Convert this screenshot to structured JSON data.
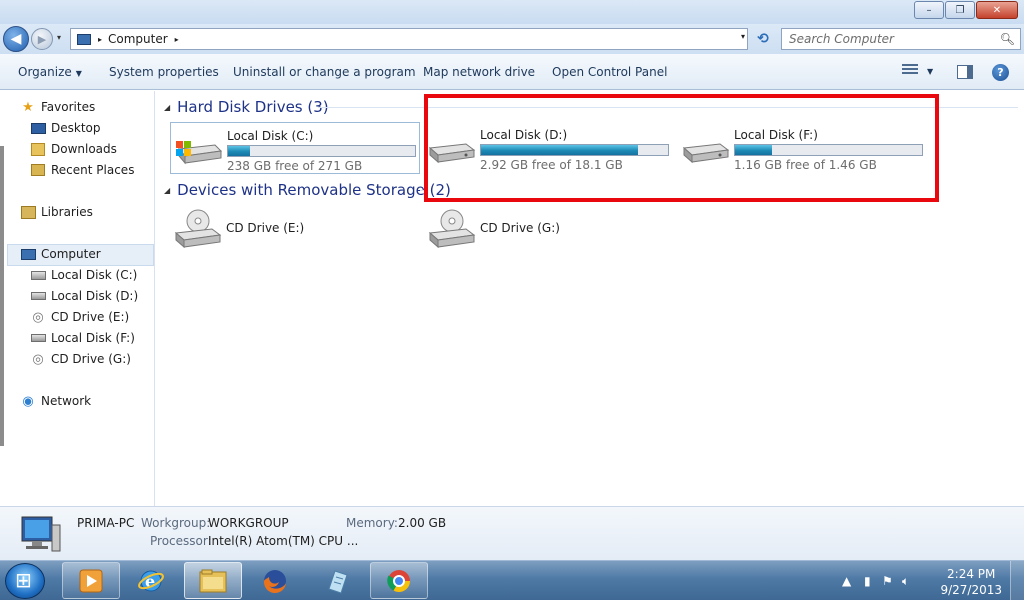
{
  "window": {
    "minimize_glyph": "–",
    "maximize_glyph": "❐",
    "close_glyph": "✕"
  },
  "address": {
    "crumb": "Computer",
    "separator": "▸",
    "dropdown": "▾",
    "refresh_glyph": "⟲"
  },
  "search": {
    "placeholder": "Search Computer",
    "icon": "search-icon"
  },
  "toolbar": {
    "organize": "Organize",
    "system_properties": "System properties",
    "uninstall": "Uninstall or change a program",
    "map_drive": "Map network drive",
    "control_panel": "Open Control Panel",
    "help_glyph": "?",
    "caret": "▼"
  },
  "navpane": {
    "favorites": "Favorites",
    "desktop": "Desktop",
    "downloads": "Downloads",
    "recent_places": "Recent Places",
    "libraries": "Libraries",
    "computer": "Computer",
    "local_c": "Local Disk (C:)",
    "local_d": "Local Disk (D:)",
    "cd_e": "CD Drive (E:)",
    "local_f": "Local Disk (F:)",
    "cd_g": "CD Drive (G:)",
    "network": "Network"
  },
  "groups": {
    "hdd": "Hard Disk Drives (3)",
    "removable": "Devices with Removable Storage (2)"
  },
  "drives": [
    {
      "name": "Local Disk (C:)",
      "free": "238 GB free of 271 GB",
      "used_fraction": 0.12
    },
    {
      "name": "Local Disk (D:)",
      "free": "2.92 GB free of 18.1 GB",
      "used_fraction": 0.84
    },
    {
      "name": "Local Disk (F:)",
      "free": "1.16 GB free of 1.46 GB",
      "used_fraction": 0.2
    }
  ],
  "removable": [
    {
      "name": "CD Drive (E:)"
    },
    {
      "name": "CD Drive (G:)"
    }
  ],
  "details": {
    "pc_name": "PRIMA-PC",
    "workgroup_label": "Workgroup:",
    "workgroup": "WORKGROUP",
    "memory_label": "Memory:",
    "memory": "2.00 GB",
    "processor_label": "Processor:",
    "processor": "Intel(R) Atom(TM) CPU ..."
  },
  "taskbar": {
    "time": "2:24 PM",
    "date": "9/27/2013"
  },
  "colors": {
    "highlight": "#e8080e",
    "bar_fill": "#1d8ab5",
    "group_heading": "#1e3287"
  }
}
